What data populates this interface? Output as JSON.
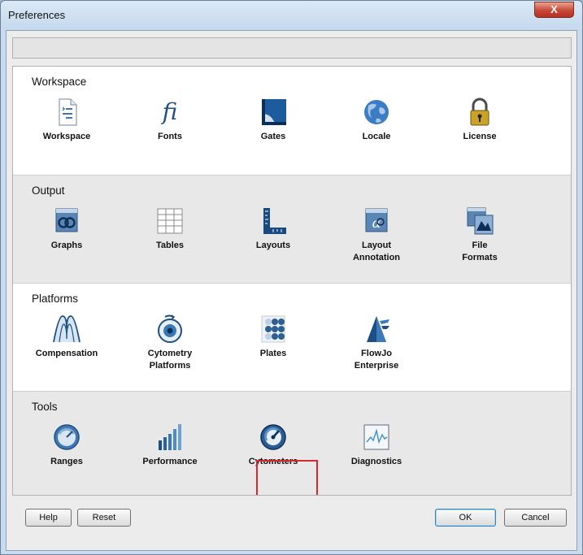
{
  "window": {
    "title": "Preferences",
    "close_label": "X"
  },
  "sections": {
    "workspace": {
      "title": "Workspace",
      "items": [
        {
          "label": "Workspace",
          "icon": "workspace-document-icon"
        },
        {
          "label": "Fonts",
          "icon": "fonts-fi-icon"
        },
        {
          "label": "Gates",
          "icon": "gates-icon"
        },
        {
          "label": "Locale",
          "icon": "globe-icon"
        },
        {
          "label": "License",
          "icon": "padlock-icon"
        }
      ]
    },
    "output": {
      "title": "Output",
      "items": [
        {
          "label": "Graphs",
          "icon": "graphs-icon"
        },
        {
          "label": "Tables",
          "icon": "table-grid-icon"
        },
        {
          "label": "Layouts",
          "icon": "layouts-ruler-icon"
        },
        {
          "label": "Layout\nAnnotation",
          "icon": "layout-annotation-icon"
        },
        {
          "label": "File\nFormats",
          "icon": "file-formats-icon"
        }
      ]
    },
    "platforms": {
      "title": "Platforms",
      "items": [
        {
          "label": "Compensation",
          "icon": "compensation-icon"
        },
        {
          "label": "Cytometry\nPlatforms",
          "icon": "cytometry-platforms-icon"
        },
        {
          "label": "Plates",
          "icon": "plates-icon"
        },
        {
          "label": "FlowJo\nEnterprise",
          "icon": "flowjo-enterprise-icon"
        }
      ]
    },
    "tools": {
      "title": "Tools",
      "items": [
        {
          "label": "Ranges",
          "icon": "ranges-dial-icon"
        },
        {
          "label": "Performance",
          "icon": "performance-bars-icon"
        },
        {
          "label": "Cytometers",
          "icon": "cytometers-gauge-icon",
          "selected": true
        },
        {
          "label": "Diagnostics",
          "icon": "diagnostics-chart-icon"
        }
      ]
    }
  },
  "buttons": {
    "help": "Help",
    "reset": "Reset",
    "ok": "OK",
    "cancel": "Cancel"
  },
  "colors": {
    "highlight": "#d9272e",
    "accent_blue": "#3a78b8"
  }
}
